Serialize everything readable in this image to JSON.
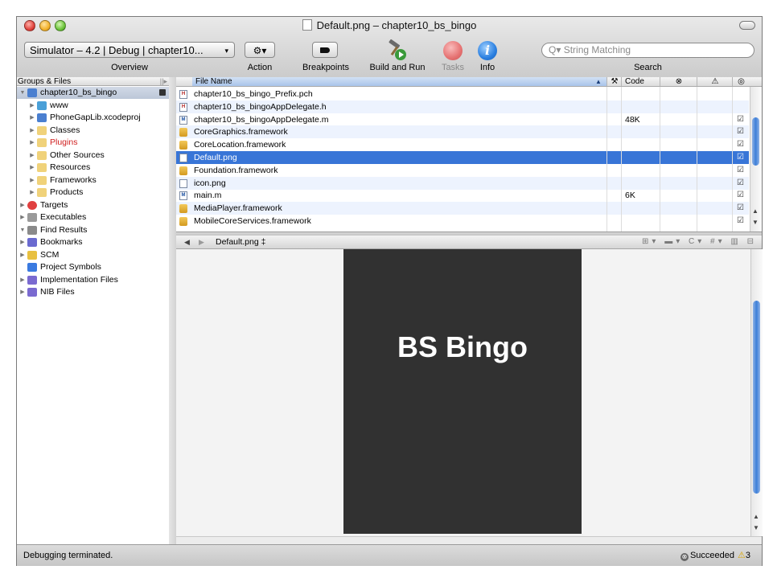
{
  "window": {
    "title": "Default.png – chapter10_bs_bingo"
  },
  "toolbar": {
    "scheme_label": "Simulator – 4.2 | Debug | chapter10...",
    "scheme_arrow": "▾",
    "overview_label": "Overview",
    "action_glyph": "⚙▾",
    "action_label": "Action",
    "breakpoints_label": "Breakpoints",
    "build_run_label": "Build and Run",
    "tasks_label": "Tasks",
    "info_glyph": "i",
    "info_label": "Info",
    "search_placeholder": "String Matching",
    "search_prefix": "Q▾",
    "search_label": "Search"
  },
  "sidebar": {
    "header": "Groups & Files",
    "items": [
      {
        "label": "chapter10_bs_bingo",
        "indent": 0,
        "expanded": true,
        "icon": "project-icon",
        "color": "#4a7fd0",
        "selected": true
      },
      {
        "label": "www",
        "indent": 1,
        "expanded": false,
        "icon": "folder-icon",
        "color": "#4aa0d8"
      },
      {
        "label": "PhoneGapLib.xcodeproj",
        "indent": 1,
        "expanded": false,
        "icon": "project-icon",
        "color": "#4a7fd0"
      },
      {
        "label": "Classes",
        "indent": 1,
        "expanded": false,
        "icon": "folder-icon",
        "color": "#f0d27a"
      },
      {
        "label": "Plugins",
        "indent": 1,
        "expanded": false,
        "icon": "folder-icon",
        "color": "#f0d27a",
        "text_color": "#d02020"
      },
      {
        "label": "Other Sources",
        "indent": 1,
        "expanded": false,
        "icon": "folder-icon",
        "color": "#f0d27a"
      },
      {
        "label": "Resources",
        "indent": 1,
        "expanded": false,
        "icon": "folder-icon",
        "color": "#f0d27a"
      },
      {
        "label": "Frameworks",
        "indent": 1,
        "expanded": false,
        "icon": "folder-icon",
        "color": "#f0d27a"
      },
      {
        "label": "Products",
        "indent": 1,
        "expanded": false,
        "icon": "folder-icon",
        "color": "#f0d27a"
      },
      {
        "label": "Targets",
        "indent": 0,
        "expanded": false,
        "icon": "target-icon",
        "color": "#e04040"
      },
      {
        "label": "Executables",
        "indent": 0,
        "expanded": false,
        "icon": "executable-icon",
        "color": "#9a9a9a"
      },
      {
        "label": "Find Results",
        "indent": 0,
        "expanded": true,
        "icon": "magnifier-icon",
        "color": "#8a8a8a"
      },
      {
        "label": "Bookmarks",
        "indent": 0,
        "expanded": false,
        "icon": "bookmark-icon",
        "color": "#6a6ad0"
      },
      {
        "label": "SCM",
        "indent": 0,
        "expanded": false,
        "icon": "scm-icon",
        "color": "#e8c040"
      },
      {
        "label": "Project Symbols",
        "indent": 0,
        "expanded": null,
        "icon": "symbols-icon",
        "color": "#3a7ae0"
      },
      {
        "label": "Implementation Files",
        "indent": 0,
        "expanded": false,
        "icon": "smart-group-icon",
        "color": "#7a6ad0"
      },
      {
        "label": "NIB Files",
        "indent": 0,
        "expanded": false,
        "icon": "smart-group-icon",
        "color": "#7a6ad0"
      }
    ]
  },
  "filelist": {
    "headers": {
      "file_name": "File Name",
      "sort_glyph": "▲",
      "build_glyph": "⚒",
      "code": "Code",
      "errors_glyph": "⊗",
      "warnings_glyph": "⚠",
      "target_glyph": "◎"
    },
    "rows": [
      {
        "name": "chapter10_bs_bingo_Prefix.pch",
        "type": "h",
        "code": "",
        "checked": false
      },
      {
        "name": "chapter10_bs_bingoAppDelegate.h",
        "type": "h",
        "code": "",
        "checked": false
      },
      {
        "name": "chapter10_bs_bingoAppDelegate.m",
        "type": "m",
        "code": "48K",
        "checked": true
      },
      {
        "name": "CoreGraphics.framework",
        "type": "fw",
        "code": "",
        "checked": true
      },
      {
        "name": "CoreLocation.framework",
        "type": "fw",
        "code": "",
        "checked": true
      },
      {
        "name": "Default.png",
        "type": "png",
        "code": "",
        "checked": true,
        "selected": true
      },
      {
        "name": "Foundation.framework",
        "type": "fw",
        "code": "",
        "checked": true
      },
      {
        "name": "icon.png",
        "type": "png",
        "code": "",
        "checked": true
      },
      {
        "name": "main.m",
        "type": "m",
        "code": "6K",
        "checked": true
      },
      {
        "name": "MediaPlayer.framework",
        "type": "fw",
        "code": "",
        "checked": true
      },
      {
        "name": "MobileCoreServices.framework",
        "type": "fw",
        "code": "",
        "checked": true
      }
    ]
  },
  "editor": {
    "nav_back": "◀",
    "nav_forward": "▶",
    "file_name": "Default.png ‡",
    "tools": "⊞▾ ▬▾ C▾ #▾ ▥ ⊟",
    "splash_title": "BS Bingo",
    "splash_bg": "#313131"
  },
  "status": {
    "left": "Debugging terminated.",
    "result": "Succeeded",
    "warning_count": "3",
    "warn_glyph": "⚠",
    "fail_glyph": "⊗"
  }
}
